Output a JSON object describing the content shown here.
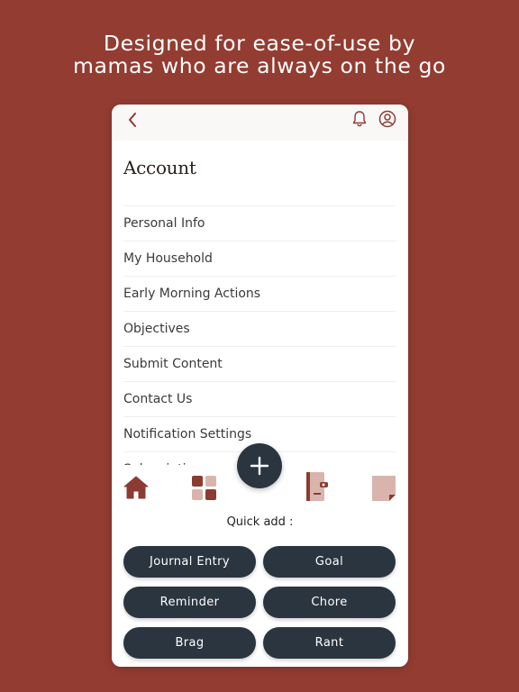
{
  "headline": {
    "line1": "Designed for ease-of-use by",
    "line2": "mamas who are always on the go"
  },
  "colors": {
    "background": "#933c31",
    "accent": "#8c3b32",
    "dark_button": "#2b3540",
    "nav_icon_light": "#d9b4ac"
  },
  "topbar": {
    "back_icon": "chevron-left-icon",
    "bell_icon": "bell-icon",
    "profile_icon": "user-circle-icon"
  },
  "page": {
    "title": "Account"
  },
  "menu": {
    "items": [
      "Personal Info",
      "My Household",
      "Early Morning Actions",
      "Objectives",
      "Submit Content",
      "Contact Us",
      "Notification Settings",
      "Subscription"
    ]
  },
  "fab": {
    "icon": "plus-icon"
  },
  "bottom_nav": {
    "icons": [
      "home-icon",
      "grid-icon",
      "journal-icon",
      "note-icon"
    ]
  },
  "quick_add": {
    "label": "Quick add :",
    "buttons": [
      "Journal Entry",
      "Goal",
      "Reminder",
      "Chore",
      "Brag",
      "Rant"
    ]
  }
}
